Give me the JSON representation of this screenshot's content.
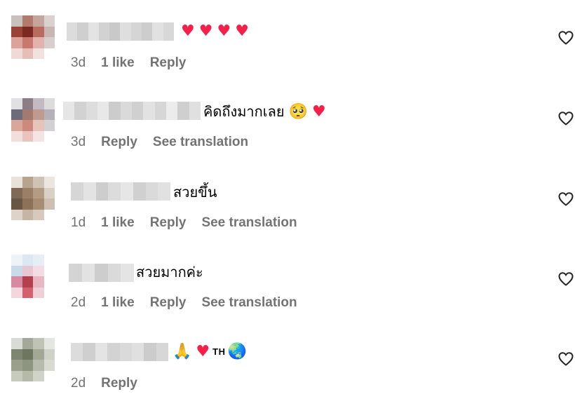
{
  "colors": {
    "meta_text": "#737373",
    "heart": "#f5204a",
    "text": "#000000"
  },
  "comments": [
    {
      "avatar_pixels": [
        "#c9c1bd",
        "#b07a6c",
        "#c4a49c",
        "#d9d2cf",
        "#9a4233",
        "#7a2a22",
        "#b86c5e",
        "#c7b6b2",
        "#dca39a",
        "#c8786e",
        "#e2b3ac",
        "#d6cfcd",
        "#f0dad8",
        "#e7bdb8",
        "#f2e2df",
        "#ffffff"
      ],
      "username_pixels": [
        "#dcdcdc",
        "#cfcfcf",
        "#e3e3e3",
        "#d2d2d2",
        "#c9c9c9",
        "#dedede",
        "#d5d5d5",
        "#cdcdcd",
        "#e1e1e1",
        "#d8d8d8"
      ],
      "text": "",
      "emojis": [
        "♥",
        "♥",
        "♥",
        "♥"
      ],
      "time": "3d",
      "likes": "1 like",
      "reply": "Reply",
      "translation": ""
    },
    {
      "avatar_pixels": [
        "#e1e0e2",
        "#8d7d84",
        "#c4bbc2",
        "#dcdcdc",
        "#6d6d7a",
        "#a27a6f",
        "#c09a8e",
        "#b4b2b8",
        "#d8a69b",
        "#cc8a7f",
        "#e6c3bb",
        "#d2d0d3",
        "#f1dfdc",
        "#e9c3bd",
        "#f3e5e3",
        "#ffffff"
      ],
      "username_pixels": [
        "#e6e6e6",
        "#d2d2d2",
        "#dddddd",
        "#e8e8e8",
        "#cccccc",
        "#dadada",
        "#d0d0d0",
        "#e2e2e2",
        "#d6d6d6",
        "#ececec",
        "#cfcfcf",
        "#e0e0e0"
      ],
      "text": "คิดถึงมากเลย",
      "emojis": [
        "🥺",
        "♥"
      ],
      "time": "3d",
      "likes": "",
      "reply": "Reply",
      "translation": "See translation"
    },
    {
      "avatar_pixels": [
        "#e8e2da",
        "#b8a48e",
        "#cfc3b5",
        "#ebe6df",
        "#7e6a55",
        "#9b8066",
        "#b39c84",
        "#d9d0c6",
        "#6a5644",
        "#8d7257",
        "#a68d73",
        "#cdbfb1",
        "#ddd3c9",
        "#c6b5a4",
        "#d7cabd",
        "#ffffff"
      ],
      "username_pixels": [
        "#d6d6d6",
        "#e3e3e3",
        "#cdcdcd",
        "#dcdcdc",
        "#e6e6e6",
        "#d0d0d0",
        "#dadada",
        "#e1e1e1"
      ],
      "text": "สวยขึ้น",
      "emojis": [],
      "time": "1d",
      "likes": "1 like",
      "reply": "Reply",
      "translation": "See translation"
    },
    {
      "avatar_pixels": [
        "#eef3f8",
        "#dbe7f2",
        "#e6eef5",
        "#ffffff",
        "#c9dbea",
        "#e7c8d2",
        "#f2dde4",
        "#ffffff",
        "#d88aa2",
        "#b2404f",
        "#e7b7c3",
        "#ffffff",
        "#f3d6de",
        "#d3606f",
        "#f0d0d8",
        "#ffffff"
      ],
      "username_pixels": [
        "#d4d4d4",
        "#e2e2e2",
        "#cdcdcd",
        "#dadada",
        "#e4e4e4"
      ],
      "text": "สวยมากค่ะ",
      "emojis": [],
      "time": "2d",
      "likes": "1 like",
      "reply": "Reply",
      "translation": "See translation"
    },
    {
      "avatar_pixels": [
        "#d9dcd6",
        "#a4a899",
        "#bfc3b6",
        "#e4e6e1",
        "#7e8570",
        "#6f765f",
        "#a3a894",
        "#cfd2c9",
        "#9aa08b",
        "#8d9480",
        "#b7bbad",
        "#d8dad3",
        "#c7cbbd",
        "#b5baa8",
        "#d0d3c8",
        "#ffffff"
      ],
      "username_pixels": [
        "#dcdcdc",
        "#cfcfcf",
        "#e4e4e4",
        "#d3d3d3",
        "#dadada",
        "#e0e0e0",
        "#cccccc",
        "#d7d7d7"
      ],
      "text": "",
      "emojis": [
        "🙏",
        "♥"
      ],
      "flag_text": "TH",
      "globe": "🌏",
      "time": "2d",
      "likes": "",
      "reply": "Reply",
      "translation": ""
    }
  ]
}
